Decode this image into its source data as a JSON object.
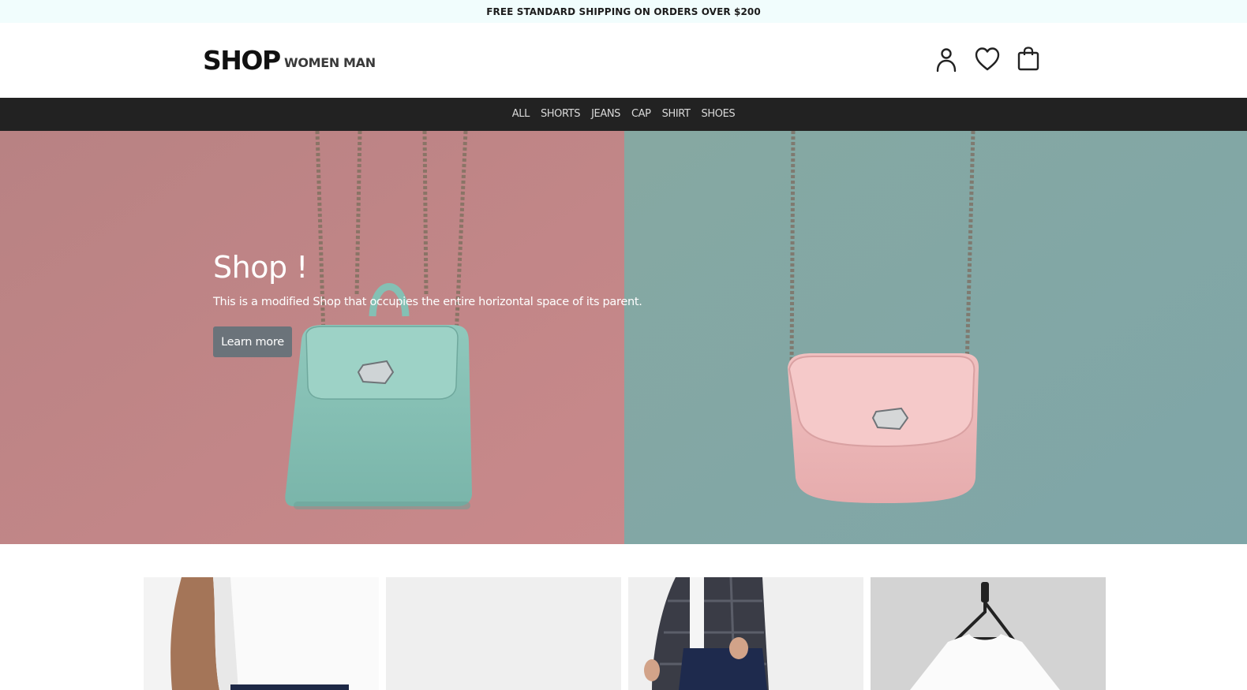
{
  "promo_bar": {
    "text": "FREE STANDARD SHIPPING ON ORDERS OVER $200"
  },
  "header": {
    "logo": "SHOP",
    "gender_links": [
      "WOMEN",
      "MAN"
    ],
    "icons": [
      "user-icon",
      "heart-icon",
      "shopping-bag-icon"
    ]
  },
  "category_nav": {
    "items": [
      "ALL",
      "SHORTS",
      "JEANS",
      "CAP",
      "SHIRT",
      "SHOES"
    ]
  },
  "hero": {
    "title": "Shop !",
    "text": "This is a modified Shop that occupies the entire horizontal space of its parent.",
    "button_label": "Learn more"
  },
  "products": [
    {
      "image": "white-tee-model-image"
    },
    {
      "image": "light-grey-product-image"
    },
    {
      "image": "plaid-shirt-jeans-model-image"
    },
    {
      "image": "white-tee-on-hanger-image"
    }
  ],
  "colors": {
    "hero_left_bg": "#c58a8b",
    "hero_right_bg": "#8ab3ad",
    "nav_bg": "#222222",
    "promo_bg": "#f1fdfd",
    "button_bg": "#6b737a"
  }
}
